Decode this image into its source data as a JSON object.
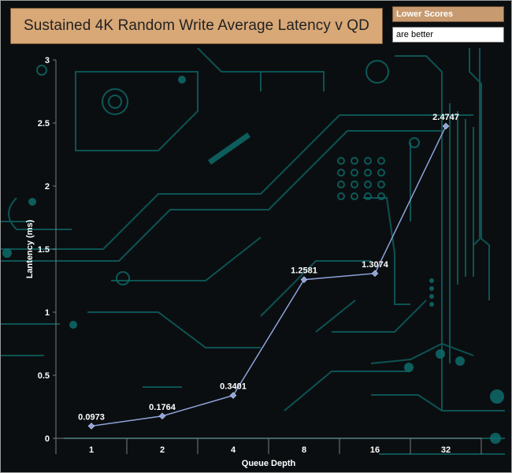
{
  "header": {
    "title": "Sustained 4K Random Write Average Latency v QD",
    "note_line1": "Lower Scores",
    "note_line2": "are better"
  },
  "colors": {
    "background": "#0b0e10",
    "circuit": "#0e6b6b",
    "series_line": "#8fa3dc",
    "title_box": "#d9a877"
  },
  "chart_data": {
    "type": "line",
    "title": "Sustained 4K Random Write Average Latency v QD",
    "xlabel": "Queue Depth",
    "ylabel": "Lantency (ms)",
    "categories": [
      "1",
      "2",
      "4",
      "8",
      "16",
      "32"
    ],
    "series": [
      {
        "values": [
          0.0973,
          0.1764,
          0.3401,
          1.2581,
          1.3074,
          2.4747
        ]
      }
    ],
    "data_labels": [
      "0.0973",
      "0.1764",
      "0.3401",
      "1.2581",
      "1.3074",
      "2.4747"
    ],
    "ylim": [
      0,
      3
    ],
    "yticks": [
      0,
      0.5,
      1,
      1.5,
      2,
      2.5,
      3
    ],
    "ytick_labels": [
      "0",
      "0.5",
      "1",
      "1.5",
      "2",
      "2.5",
      "3"
    ],
    "grid": false,
    "legend": "none"
  }
}
